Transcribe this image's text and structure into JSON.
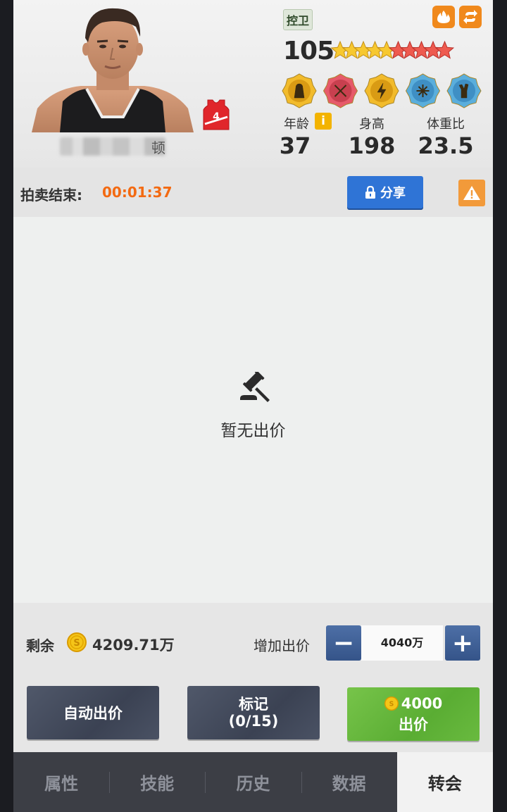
{
  "player": {
    "position": "控卫",
    "name_tail": "顿",
    "jersey_number": "4",
    "rating": "105",
    "stars_gold": 5,
    "stars_red": 5,
    "skill_badges": [
      "player-silhouette-badge",
      "ball-badge",
      "lightning-badge",
      "web-badge",
      "hand-badge"
    ],
    "stats": {
      "age_label": "年龄",
      "age_value": "37",
      "height_label": "身高",
      "height_value": "198",
      "weight_ratio_label": "体重比",
      "weight_ratio_value": "23.5"
    },
    "info_icon": "i"
  },
  "auction": {
    "end_label": "拍卖结束:",
    "timer": "00:01:37",
    "share_label": "分享"
  },
  "bids": {
    "empty_text": "暂无出价"
  },
  "bottom": {
    "remaining_label": "剩余",
    "remaining_value": "4209.71万",
    "increase_label": "增加出价",
    "bid_amount": "4040万",
    "minus_label": "−",
    "plus_label": "+",
    "auto_bid_label": "自动出价",
    "mark_label": "标记",
    "mark_count": "(0/15)",
    "bid_price": "4000",
    "bid_label": "出价"
  },
  "tabs": [
    {
      "label": "属性",
      "active": false
    },
    {
      "label": "技能",
      "active": false
    },
    {
      "label": "历史",
      "active": false
    },
    {
      "label": "数据",
      "active": false
    },
    {
      "label": "转会",
      "active": true
    }
  ],
  "colors": {
    "timer": "#f36a12",
    "share_button": "#2f74d6",
    "bid_button": "#5aad33",
    "stepper": "#355489",
    "tab_bar": "#3c3e45"
  }
}
